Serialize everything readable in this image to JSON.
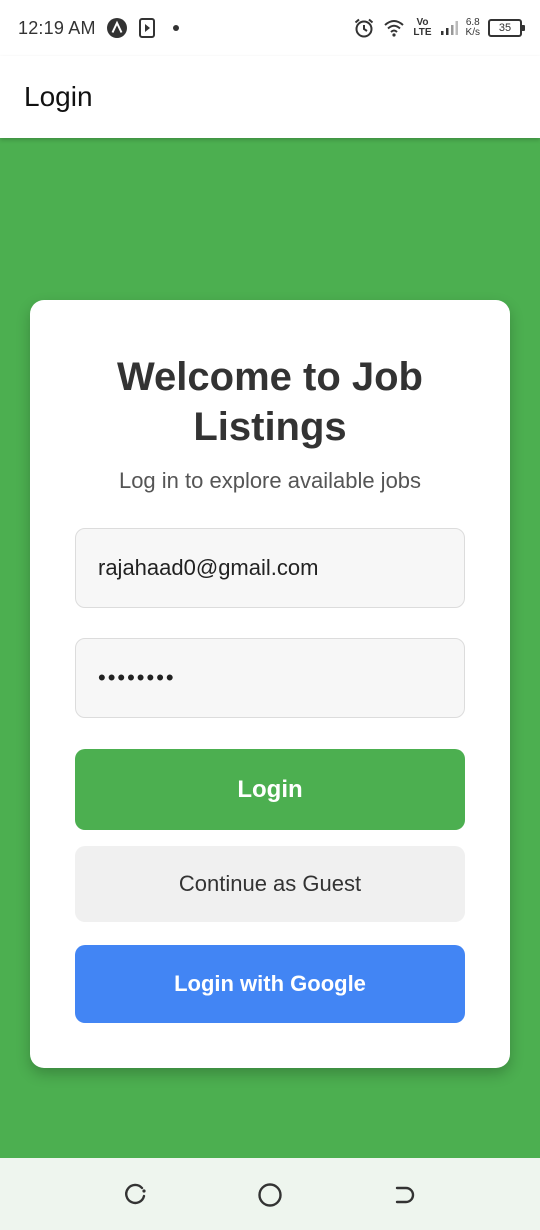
{
  "status_bar": {
    "time": "12:19 AM",
    "network_speed_value": "6.8",
    "network_speed_unit": "K/s",
    "volte_top": "Vo",
    "volte_bottom": "LTE",
    "battery": "35",
    "icons": [
      "app-a-icon",
      "media-player-icon",
      "notification-dot-icon",
      "alarm-icon",
      "wifi-icon",
      "signal-icon",
      "battery-icon"
    ]
  },
  "app_bar": {
    "title": "Login"
  },
  "card": {
    "title_line1": "Welcome to Job",
    "title_line2": "Listings",
    "subtitle": "Log in to explore available jobs"
  },
  "form": {
    "email_value": "rajahaad0@gmail.com",
    "password_value": "••••••••"
  },
  "buttons": {
    "login": "Login",
    "guest": "Continue as Guest",
    "google": "Login with Google"
  },
  "nav_bar": {
    "icons": [
      "back-icon",
      "home-icon",
      "recents-icon"
    ]
  },
  "colors": {
    "background_green": "#4caf50",
    "login_button": "#4caf50",
    "google_button": "#4285f4",
    "guest_button": "#f0f0f0",
    "card": "#ffffff"
  }
}
